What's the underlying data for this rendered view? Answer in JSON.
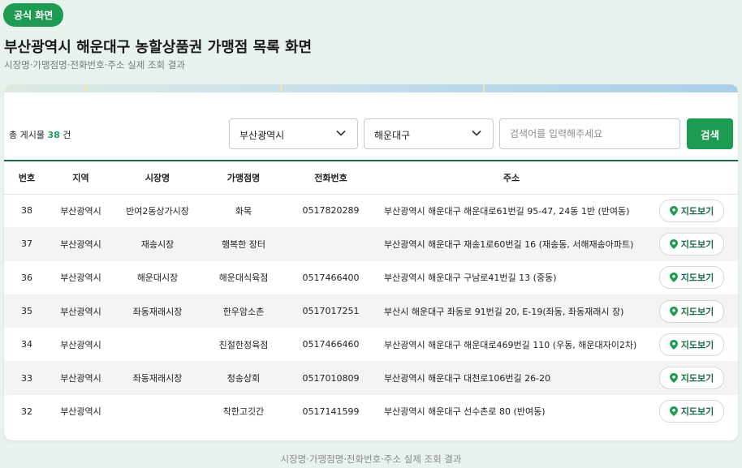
{
  "badge": "공식 화면",
  "title": "부산광역시 해운대구 농할상품권 가맹점 목록 화면",
  "subtitle": "시장명·가맹점명·전화번호·주소 실제 조회 결과",
  "toolbar": {
    "count_prefix": "총 게시물",
    "count_value": "38",
    "count_suffix": "건",
    "region_select": "부산광역시",
    "district_select": "해운대구",
    "search_placeholder": "검색어를 입력해주세요",
    "search_button": "검색"
  },
  "table": {
    "headers": [
      "번호",
      "지역",
      "시장명",
      "가맹점명",
      "전화번호",
      "주소",
      ""
    ],
    "map_button_label": "지도보기",
    "rows": [
      {
        "no": "38",
        "region": "부산광역시",
        "market": "반여2동상가시장",
        "store": "화목",
        "phone": "0517820289",
        "address": "부산광역시 해운대구 해운대로61번길 95-47, 24동 1반 (반여동)"
      },
      {
        "no": "37",
        "region": "부산광역시",
        "market": "재송시장",
        "store": "행복한 장터",
        "phone": "",
        "address": "부산광역시 해운대구 재송1로60번길 16 (재송동, 서해재송아파트)"
      },
      {
        "no": "36",
        "region": "부산광역시",
        "market": "해운대시장",
        "store": "해운대식육점",
        "phone": "0517466400",
        "address": "부산광역시 해운대구 구남로41번길 13 (중동)"
      },
      {
        "no": "35",
        "region": "부산광역시",
        "market": "좌동재래시장",
        "store": "한우암소촌",
        "phone": "0517017251",
        "address": "부산시 해운대구 좌동로 91번길 20, E-19(좌동, 좌동재래시 장)"
      },
      {
        "no": "34",
        "region": "부산광역시",
        "market": "",
        "store": "친절한정육점",
        "phone": "0517466460",
        "address": "부산광역시 해운대구 해운대로469번길 110 (우동, 해운대자이2차)"
      },
      {
        "no": "33",
        "region": "부산광역시",
        "market": "좌동재래시장",
        "store": "청송상회",
        "phone": "0517010809",
        "address": "부산광역시 해운대구 대천로106번길 26-20"
      },
      {
        "no": "32",
        "region": "부산광역시",
        "market": "",
        "store": "착한고깃간",
        "phone": "0517141599",
        "address": "부산광역시 해운대구 선수촌로 80 (반여동)"
      }
    ]
  },
  "footer": "시장명·가맹점명·전화번호·주소 실제 조회 결과",
  "colors": {
    "accent": "#1f9a53",
    "header_rule": "#1a6b43",
    "background": "#e9f3ee"
  }
}
